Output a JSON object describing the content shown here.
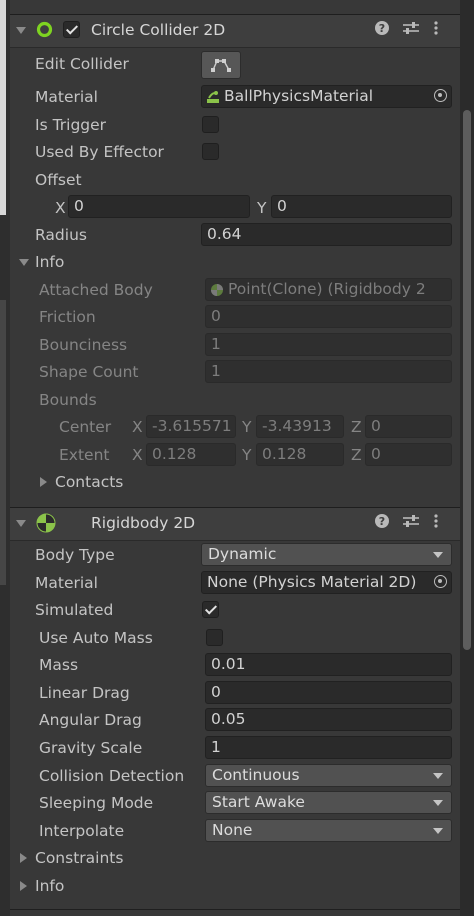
{
  "circle_collider": {
    "title": "Circle Collider 2D",
    "enabled": true,
    "edit_collider_label": "Edit Collider",
    "material_label": "Material",
    "material_value": "BallPhysicsMaterial",
    "is_trigger_label": "Is Trigger",
    "is_trigger": false,
    "used_by_effector_label": "Used By Effector",
    "used_by_effector": false,
    "offset_label": "Offset",
    "offset_x_label": "X",
    "offset_x": "0",
    "offset_y_label": "Y",
    "offset_y": "0",
    "radius_label": "Radius",
    "radius": "0.64",
    "info": {
      "label": "Info",
      "attached_body_label": "Attached Body",
      "attached_body_value": "Point(Clone) (Rigidbody 2",
      "friction_label": "Friction",
      "friction": "0",
      "bounciness_label": "Bounciness",
      "bounciness": "1",
      "shape_count_label": "Shape Count",
      "shape_count": "1",
      "bounds_label": "Bounds",
      "center_label": "Center",
      "center_x": "-3.615571",
      "center_y": "-3.43913",
      "center_z": "0",
      "extent_label": "Extent",
      "extent_x": "0.128",
      "extent_y": "0.128",
      "extent_z": "0",
      "x_label": "X",
      "y_label": "Y",
      "z_label": "Z",
      "contacts_label": "Contacts"
    }
  },
  "rigidbody": {
    "title": "Rigidbody 2D",
    "body_type_label": "Body Type",
    "body_type": "Dynamic",
    "material_label": "Material",
    "material_value": "None (Physics Material 2D)",
    "simulated_label": "Simulated",
    "simulated": true,
    "use_auto_mass_label": "Use Auto Mass",
    "use_auto_mass": false,
    "mass_label": "Mass",
    "mass": "0.01",
    "linear_drag_label": "Linear Drag",
    "linear_drag": "0",
    "angular_drag_label": "Angular Drag",
    "angular_drag": "0.05",
    "gravity_scale_label": "Gravity Scale",
    "gravity_scale": "1",
    "collision_detection_label": "Collision Detection",
    "collision_detection": "Continuous",
    "sleeping_mode_label": "Sleeping Mode",
    "sleeping_mode": "Start Awake",
    "interpolate_label": "Interpolate",
    "interpolate": "None",
    "constraints_label": "Constraints",
    "info_label": "Info"
  },
  "header_icons": [
    "help-icon",
    "preset-sliders-icon",
    "context-menu-icon"
  ],
  "colors": {
    "panel_bg": "#383838",
    "header_bg": "#3e3e3e",
    "field_bg": "#2a2a2a",
    "collider_green": "#7ed321",
    "rigidbody_green": "#8bc34a"
  }
}
